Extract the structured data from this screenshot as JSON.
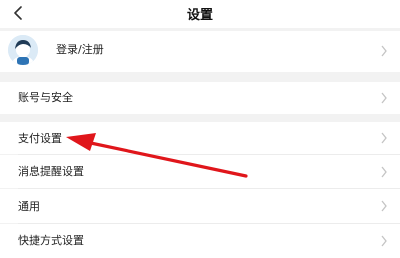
{
  "header": {
    "title": "设置",
    "back_icon": "back-chevron-icon"
  },
  "account": {
    "label": "登录/注册"
  },
  "items": [
    {
      "label": "账号与安全"
    },
    {
      "label": "支付设置"
    },
    {
      "label": "消息提醒设置"
    },
    {
      "label": "通用"
    },
    {
      "label": "快捷方式设置"
    }
  ],
  "colors": {
    "background": "#f2f2f2",
    "surface": "#ffffff",
    "annotation_arrow": "#e0161b"
  }
}
